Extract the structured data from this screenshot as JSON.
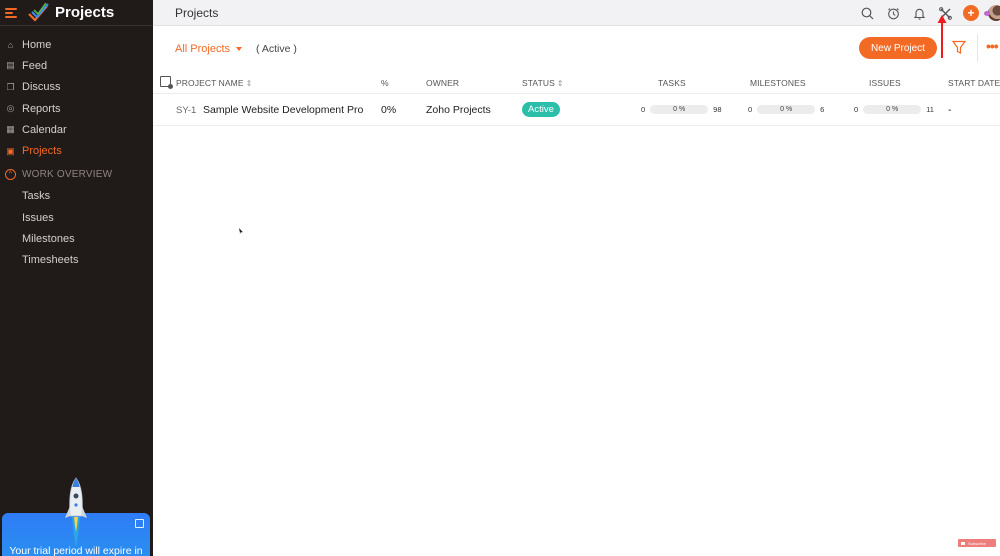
{
  "sidebar": {
    "brand": "Projects",
    "nav": [
      {
        "label": "Home",
        "icon": "home-icon",
        "active": false
      },
      {
        "label": "Feed",
        "icon": "feed-icon",
        "active": false
      },
      {
        "label": "Discuss",
        "icon": "discuss-icon",
        "active": false
      },
      {
        "label": "Reports",
        "icon": "reports-icon",
        "active": false
      },
      {
        "label": "Calendar",
        "icon": "calendar-icon",
        "active": false
      },
      {
        "label": "Projects",
        "icon": "briefcase-icon",
        "active": true
      }
    ],
    "section": "WORK OVERVIEW",
    "sub_items": [
      "Tasks",
      "Issues",
      "Milestones",
      "Timesheets"
    ],
    "trial_text": "Your trial period will expire in"
  },
  "topbar": {
    "title": "Projects",
    "icons": [
      "search-icon",
      "timer-icon",
      "bell-icon",
      "tools-icon",
      "add-icon",
      "avatar"
    ]
  },
  "filters": {
    "view": "All Projects",
    "status": "( Active )",
    "new_project": "New Project"
  },
  "table": {
    "headers": {
      "name": "PROJECT NAME",
      "percent": "%",
      "owner": "OWNER",
      "status": "STATUS",
      "tasks": "TASKS",
      "milestones": "MILESTONES",
      "issues": "ISSUES",
      "start_date": "START DATE"
    },
    "rows": [
      {
        "id": "SY-1",
        "name": "Sample Website Development Pro",
        "percent": "0%",
        "owner": "Zoho Projects",
        "status": "Active",
        "tasks": {
          "done": "0",
          "pct": "0 %",
          "total": "98",
          "fraction": 0
        },
        "milestones": {
          "done": "0",
          "pct": "0 %",
          "total": "6",
          "fraction": 0
        },
        "issues": {
          "done": "0",
          "pct": "0 %",
          "total": "11",
          "fraction": 0
        },
        "start_date": "-"
      }
    ]
  },
  "overlay": {
    "subscribe": "Subscribe"
  },
  "colors": {
    "accent": "#f26a24",
    "sidebar_bg": "#201a19",
    "status_active": "#2bbfa9",
    "trial_bg": "#2f7cf6"
  }
}
